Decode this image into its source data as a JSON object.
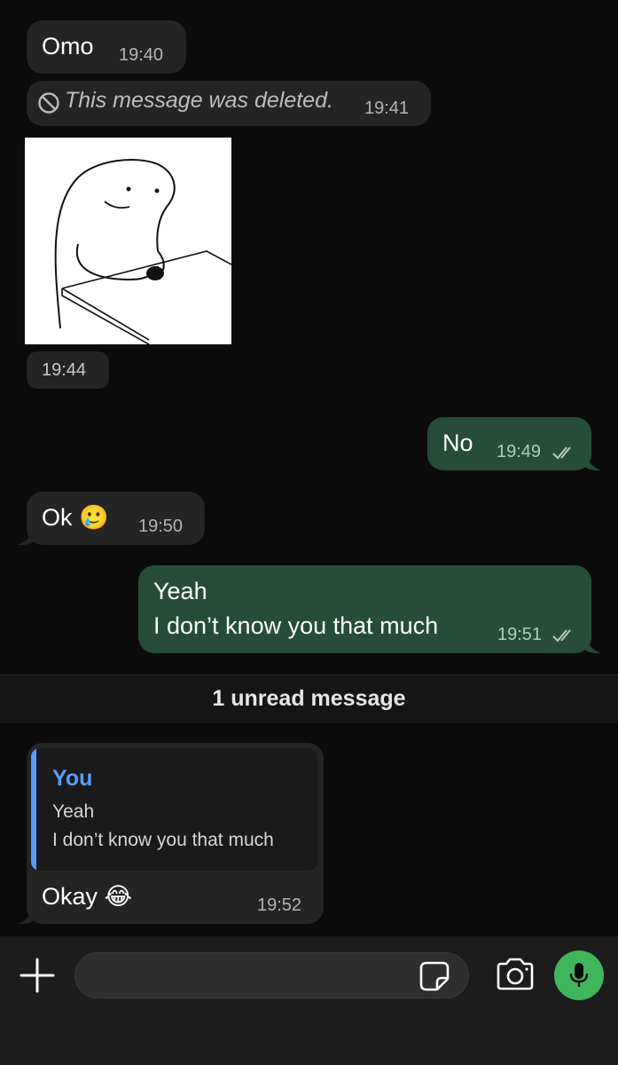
{
  "messages": {
    "omo": {
      "text": "Omo",
      "time": "19:40"
    },
    "deleted": {
      "text": "This message was deleted.",
      "time": "19:41"
    },
    "image": {
      "time": "19:44"
    },
    "no": {
      "text": "No",
      "time": "19:49"
    },
    "ok": {
      "text": "Ok 🥲",
      "time": "19:50"
    },
    "yeah": {
      "line1": "Yeah",
      "line2": "I don’t know you that much",
      "time": "19:51"
    },
    "okay": {
      "quote_author": "You",
      "quote_line1": "Yeah",
      "quote_line2": "I don’t know you that much",
      "text": "Okay 😂",
      "time": "19:52"
    }
  },
  "unread_divider": "1 unread message",
  "composer": {
    "icons": [
      "plus-icon",
      "sticker-icon",
      "camera-icon",
      "microphone-icon"
    ]
  },
  "colors": {
    "background": "#0b0b0b",
    "incoming_bubble": "#242424",
    "outgoing_bubble": "#254d39",
    "reply_accent": "#5a9cf5",
    "mic_button": "#3fb65c"
  }
}
